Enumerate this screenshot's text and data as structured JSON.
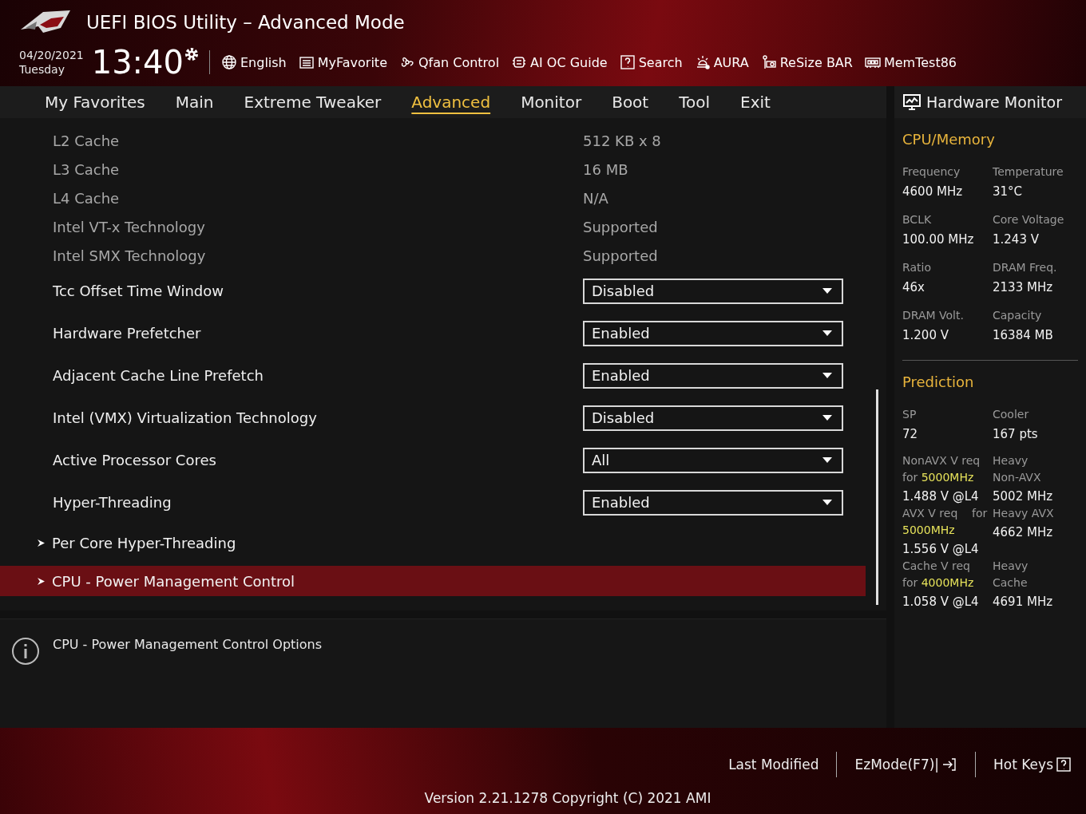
{
  "window": {
    "title": "UEFI BIOS Utility – Advanced Mode"
  },
  "clock": {
    "date": "04/20/2021",
    "day": "Tuesday",
    "time": "13:40"
  },
  "toolbar": [
    "English",
    "MyFavorite",
    "Qfan Control",
    "AI OC Guide",
    "Search",
    "AURA",
    "ReSize BAR",
    "MemTest86"
  ],
  "tabs": [
    {
      "label": "My Favorites",
      "selected": false
    },
    {
      "label": "Main",
      "selected": false
    },
    {
      "label": "Extreme Tweaker",
      "selected": false
    },
    {
      "label": "Advanced",
      "selected": true
    },
    {
      "label": "Monitor",
      "selected": false
    },
    {
      "label": "Boot",
      "selected": false
    },
    {
      "label": "Tool",
      "selected": false
    },
    {
      "label": "Exit",
      "selected": false
    }
  ],
  "settings": [
    {
      "kind": "info",
      "label": "L2 Cache",
      "value": "512 KB x 8"
    },
    {
      "kind": "info",
      "label": "L3 Cache",
      "value": "16 MB"
    },
    {
      "kind": "info",
      "label": "L4 Cache",
      "value": "N/A"
    },
    {
      "kind": "info",
      "label": "Intel VT-x Technology",
      "value": "Supported"
    },
    {
      "kind": "info",
      "label": "Intel SMX Technology",
      "value": "Supported"
    },
    {
      "kind": "dropdown",
      "label": "Tcc Offset Time Window",
      "value": "Disabled"
    },
    {
      "kind": "dropdown",
      "label": "Hardware Prefetcher",
      "value": "Enabled"
    },
    {
      "kind": "dropdown",
      "label": "Adjacent Cache Line Prefetch",
      "value": "Enabled"
    },
    {
      "kind": "dropdown",
      "label": "Intel (VMX) Virtualization Technology",
      "value": "Disabled"
    },
    {
      "kind": "dropdown",
      "label": "Active Processor Cores",
      "value": "All"
    },
    {
      "kind": "dropdown",
      "label": "Hyper-Threading",
      "value": "Enabled"
    },
    {
      "kind": "submenu",
      "label": "Per Core Hyper-Threading",
      "selected": false
    },
    {
      "kind": "submenu",
      "label": "CPU - Power Management Control",
      "selected": true
    }
  ],
  "help": "CPU - Power Management Control Options",
  "hardware_monitor": {
    "title": "Hardware Monitor",
    "cpu_memory": {
      "title": "CPU/Memory",
      "stats": [
        {
          "label": "Frequency",
          "value": "4600 MHz"
        },
        {
          "label": "Temperature",
          "value": "31°C"
        },
        {
          "label": "BCLK",
          "value": "100.00 MHz"
        },
        {
          "label": "Core Voltage",
          "value": "1.243 V"
        },
        {
          "label": "Ratio",
          "value": "46x"
        },
        {
          "label": "DRAM Freq.",
          "value": "2133 MHz"
        },
        {
          "label": "DRAM Volt.",
          "value": "1.200 V"
        },
        {
          "label": "Capacity",
          "value": "16384 MB"
        }
      ]
    },
    "prediction": {
      "title": "Prediction",
      "stats": [
        {
          "label": "SP",
          "value": "72"
        },
        {
          "label": "Cooler",
          "value": "167 pts"
        }
      ],
      "rows": [
        {
          "left_label": "NonAVX V req for",
          "left_highlight": "5000MHz",
          "left_value": "1.488 V @L4",
          "right_label": "Heavy Non-AVX",
          "right_value": "5002 MHz"
        },
        {
          "left_label": "AVX V req    for",
          "left_highlight": "5000MHz",
          "left_value": "1.556 V @L4",
          "right_label": "Heavy AVX",
          "right_value": "4662 MHz"
        },
        {
          "left_label": "Cache V req for",
          "left_highlight": "4000MHz",
          "left_value": "1.058 V @L4",
          "right_label": "Heavy Cache",
          "right_value": "4691 MHz"
        }
      ]
    }
  },
  "footer": {
    "links": [
      "Last Modified",
      "EzMode(F7)|",
      "Hot Keys"
    ],
    "version": "Version 2.21.1278 Copyright (C) 2021 AMI"
  }
}
